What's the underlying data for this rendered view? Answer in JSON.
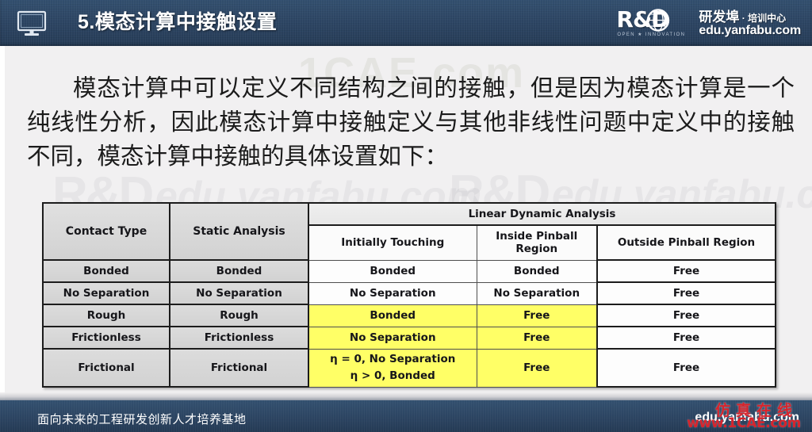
{
  "header": {
    "icon": "monitor-icon",
    "title": "5.模态计算中接触设置",
    "logo": {
      "mark": "R&D",
      "tagline": "OPEN  ★  INNOVATION",
      "cn_main": "研发埠",
      "cn_sep": " · ",
      "cn_sub": "培训中心",
      "url": "edu.yanfabu.com"
    }
  },
  "body": {
    "paragraph": "模态计算中可以定义不同结构之间的接触，但是因为模态计算是一个纯线性分析，因此模态计算中接触定义与其他非线性问题中定义中的接触不同，模态计算中接触的具体设置如下：",
    "watermarks": {
      "rd_left": "R&D",
      "edu_left": "edu.yanfabu.com",
      "rd_right": "R&D",
      "edu_right": "edu.yanfabu.com",
      "cae": "1CAE.com"
    }
  },
  "table": {
    "header": {
      "contact_type": "Contact Type",
      "static_analysis": "Static Analysis",
      "linear_dynamic_analysis": "Linear Dynamic Analysis",
      "initially_touching": "Initially Touching",
      "inside_pinball_region": "Inside Pinball Region",
      "outside_pinball_region": "Outside Pinball Region"
    },
    "rows": [
      {
        "contact_type": "Bonded",
        "static_analysis": "Bonded",
        "initially_touching": "Bonded",
        "inside_pinball": "Bonded",
        "outside_pinball": "Free",
        "highlight": false
      },
      {
        "contact_type": "No Separation",
        "static_analysis": "No Separation",
        "initially_touching": "No Separation",
        "inside_pinball": "No Separation",
        "outside_pinball": "Free",
        "highlight": false
      },
      {
        "contact_type": "Rough",
        "static_analysis": "Rough",
        "initially_touching": "Bonded",
        "inside_pinball": "Free",
        "outside_pinball": "Free",
        "highlight": true
      },
      {
        "contact_type": "Frictionless",
        "static_analysis": "Frictionless",
        "initially_touching": "No Separation",
        "inside_pinball": "Free",
        "outside_pinball": "Free",
        "highlight": true
      },
      {
        "contact_type": "Frictional",
        "static_analysis": "Frictional",
        "initially_touching_line1": "η = 0, No Separation",
        "initially_touching_line2": "η > 0, Bonded",
        "inside_pinball": "Free",
        "outside_pinball": "Free",
        "highlight": true
      }
    ],
    "highlight_color": "#ffff66",
    "header_color": "#d9d9d9"
  },
  "footer": {
    "left_text": "面向未来的工程研发创新人才培养基地",
    "right_text": "edu.yanfabu.com",
    "watermark_cn": "仿真在线",
    "watermark_url": "www.1CAE.com",
    "watermark_color": "#d7242c"
  }
}
